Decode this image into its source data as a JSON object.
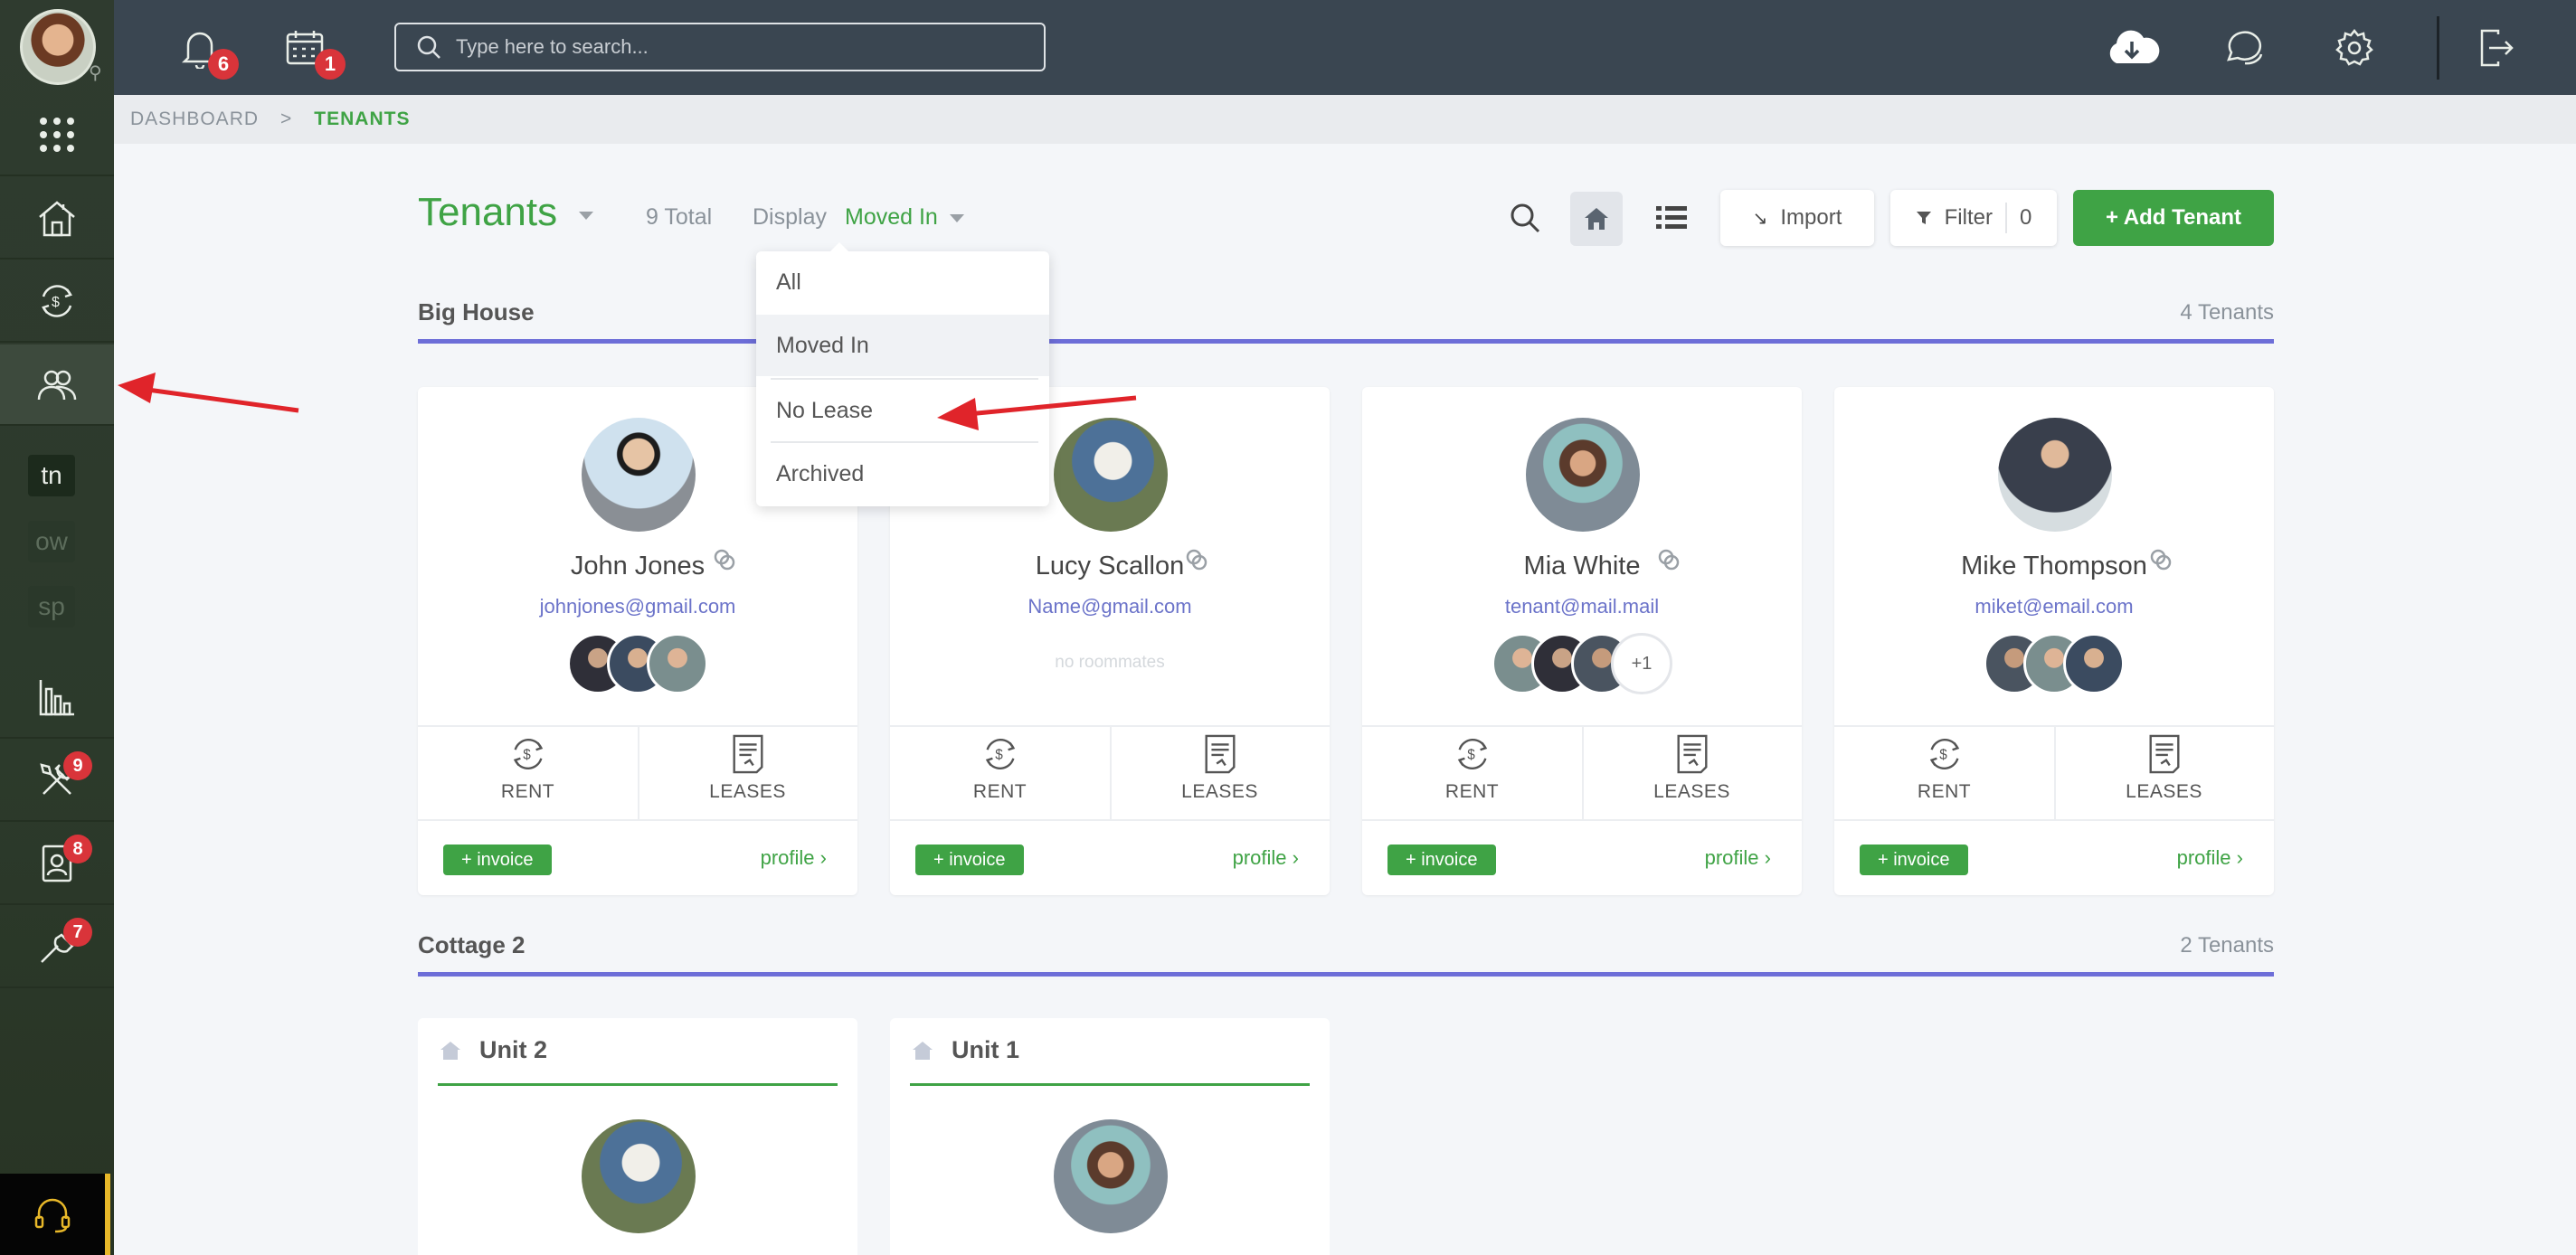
{
  "topbar": {
    "notifications_count": "6",
    "calendar_count": "1",
    "search_placeholder": "Type here to search..."
  },
  "sidebar": {
    "mini_items": [
      "tn",
      "ow",
      "sp"
    ],
    "maintenance_badge": "9",
    "applications_badge": "8",
    "tools_badge": "7"
  },
  "breadcrumb": {
    "root": "DASHBOARD",
    "separator": ">",
    "current": "TENANTS"
  },
  "header": {
    "title": "Tenants",
    "total": "9 Total",
    "display_label": "Display",
    "display_value": "Moved In",
    "import_label": "Import",
    "filter_label": "Filter",
    "filter_count": "0",
    "add_label": "+ Add Tenant"
  },
  "dropdown": {
    "options": [
      "All",
      "Moved In",
      "No Lease",
      "Archived"
    ]
  },
  "properties": [
    {
      "name": "Big House",
      "count": "4 Tenants",
      "tenants": [
        {
          "name": "John Jones",
          "email": "johnjones@gmail.com",
          "roommates_text": ""
        },
        {
          "name": "Lucy Scallon",
          "email": "Name@gmail.com",
          "roommates_text": "no roommates"
        },
        {
          "name": "Mia White",
          "email": "tenant@mail.mail",
          "roommates_text": "",
          "more": "+1"
        },
        {
          "name": "Mike Thompson",
          "email": "miket@email.com",
          "roommates_text": ""
        }
      ]
    },
    {
      "name": "Cottage 2",
      "count": "2 Tenants",
      "units": [
        {
          "name": "Unit 2"
        },
        {
          "name": "Unit 1"
        }
      ]
    }
  ],
  "card_labels": {
    "rent": "RENT",
    "leases": "LEASES",
    "invoice": "+ invoice",
    "profile": "profile"
  },
  "colors": {
    "brand_green": "#3fa345",
    "topbar": "#3a4651",
    "accent_line": "#6d6ed8",
    "badge_red": "#d9343a"
  }
}
